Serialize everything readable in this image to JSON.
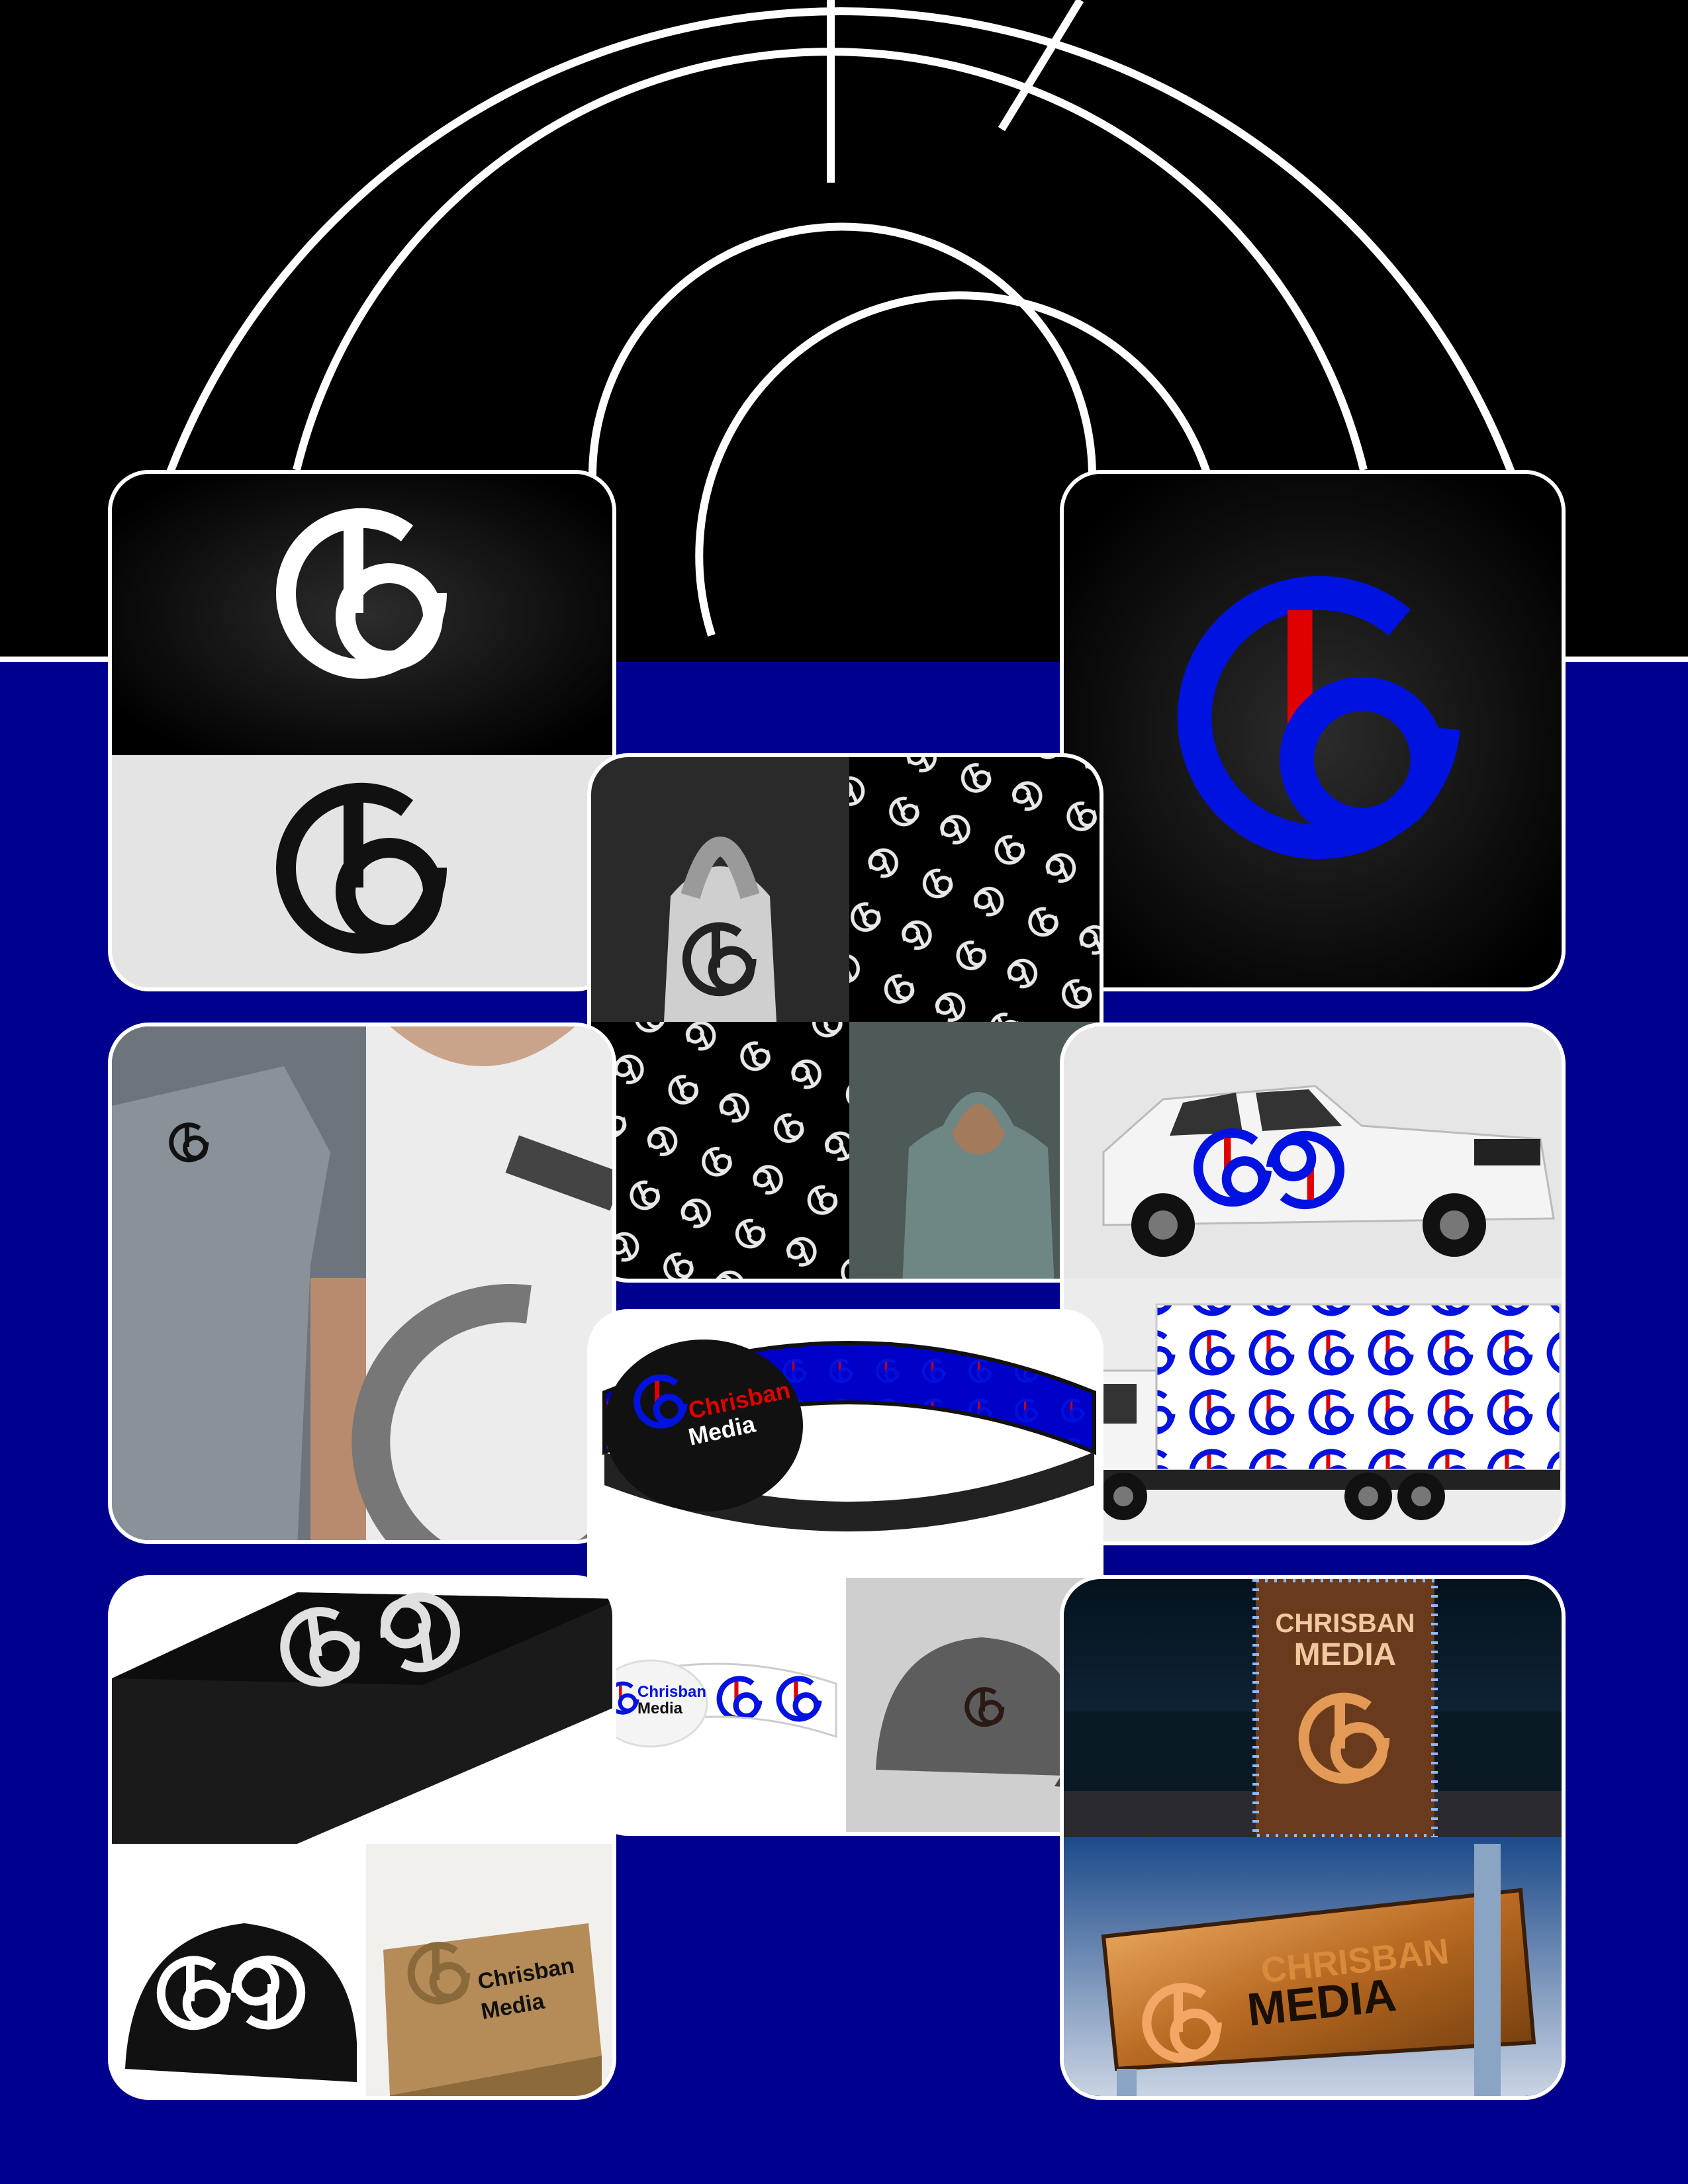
{
  "brand": {
    "primary_color": "#0012e0",
    "accent_color": "#e00000",
    "background_color": "#00008f",
    "logo_icon": "cb-monogram-icon"
  },
  "mockups": {
    "wristband_large": {
      "line1": "Chrisban",
      "line2": "Media"
    },
    "wristband_small": {
      "line1": "Chrisban",
      "line2": "Media"
    },
    "billboard_night": {
      "line1": "CHRISBAN",
      "line2": "MEDIA"
    },
    "billboard_day": {
      "line1": "CHRISBAN",
      "line2": "MEDIA"
    },
    "packaging_box": {
      "line1": "Chrisban",
      "line2": "Media"
    }
  }
}
